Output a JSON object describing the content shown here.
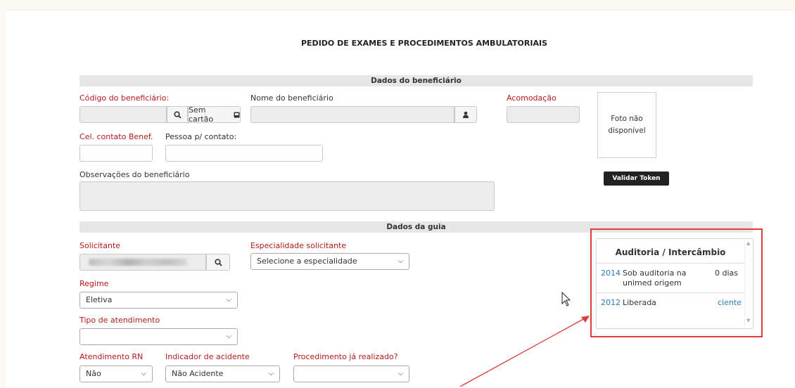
{
  "page": {
    "title": "PEDIDO DE EXAMES E PROCEDIMENTOS AMBULATORIAIS"
  },
  "beneficiario": {
    "section": "Dados do beneficiário",
    "codigo_label": "Código do beneficiário:",
    "codigo_value": "",
    "sem_cartao_label": "Sem cartão",
    "nome_label": "Nome do beneficiário",
    "nome_value": "",
    "acomodacao_label": "Acomodação",
    "acomodacao_value": "",
    "foto_label": "Foto não disponível",
    "cel_label": "Cel. contato Benef.",
    "cel_value": "",
    "pessoa_label": "Pessoa p/ contato:",
    "pessoa_value": "",
    "obs_label": "Observações do beneficiário",
    "obs_value": "",
    "validar_token_label": "Validar Token"
  },
  "guia": {
    "section": "Dados da guia",
    "solicitante_label": "Solicitante",
    "especialidade_label": "Especialidade solicitante",
    "especialidade_value": "Selecione a especialidade",
    "regime_label": "Regime",
    "regime_value": "Eletiva",
    "tipo_label": "Tipo de atendimento",
    "tipo_value": "",
    "rn_label": "Atendimento RN",
    "rn_value": "Não",
    "acidente_label": "Indicador de acidente",
    "acidente_value": "Não Acidente",
    "procedimento_label": "Procedimento já realizado?",
    "procedimento_value": ""
  },
  "auditoria": {
    "title": "Auditoria / Intercâmbio",
    "rows": [
      {
        "code": "2014",
        "status": "Sob auditoria na unimed origem",
        "info": "0 dias"
      },
      {
        "code": "2012",
        "status": "Liberada",
        "info": "ciente"
      }
    ]
  },
  "colors": {
    "required_label": "#b41a1a",
    "link": "#2a7ab8",
    "highlight": "#e03c3c"
  }
}
